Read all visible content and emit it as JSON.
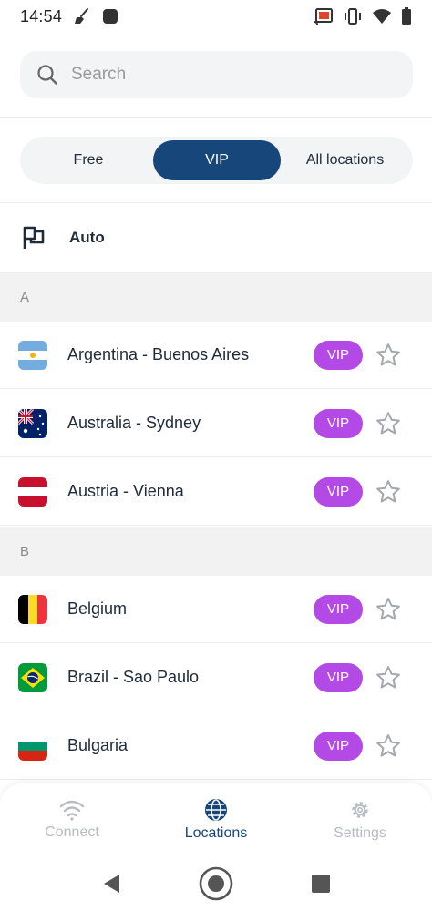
{
  "status_bar": {
    "time": "14:54",
    "left_icons": [
      "broom-icon",
      "app-square-icon"
    ],
    "right_icons": [
      "cast-icon",
      "vibrate-icon",
      "wifi-icon",
      "battery-icon"
    ]
  },
  "search": {
    "placeholder": "Search",
    "value": ""
  },
  "tabs": [
    {
      "label": "Free",
      "selected": false
    },
    {
      "label": "VIP",
      "selected": true
    },
    {
      "label": "All locations",
      "selected": false
    }
  ],
  "auto": {
    "label": "Auto",
    "icon": "flag-outline-icon"
  },
  "sections": [
    {
      "letter": "A",
      "items": [
        {
          "name": "Argentina - Buenos Aires",
          "flag": "argentina",
          "badge": "VIP"
        },
        {
          "name": "Australia - Sydney",
          "flag": "australia",
          "badge": "VIP"
        },
        {
          "name": "Austria - Vienna",
          "flag": "austria",
          "badge": "VIP"
        }
      ]
    },
    {
      "letter": "B",
      "items": [
        {
          "name": "Belgium",
          "flag": "belgium",
          "badge": "VIP"
        },
        {
          "name": "Brazil - Sao Paulo",
          "flag": "brazil",
          "badge": "VIP"
        },
        {
          "name": "Bulgaria",
          "flag": "bulgaria",
          "badge": "VIP"
        }
      ]
    }
  ],
  "bottom_nav": [
    {
      "label": "Connect",
      "icon": "wifi-icon",
      "active": false
    },
    {
      "label": "Locations",
      "icon": "globe-icon",
      "active": true
    },
    {
      "label": "Settings",
      "icon": "gear-icon",
      "active": false
    }
  ],
  "system_nav": [
    "back-icon",
    "home-icon",
    "recents-icon"
  ],
  "colors": {
    "accent": "#17467a",
    "vip_badge": "#b44ae6",
    "inactive_nav": "#b7bcc2"
  }
}
